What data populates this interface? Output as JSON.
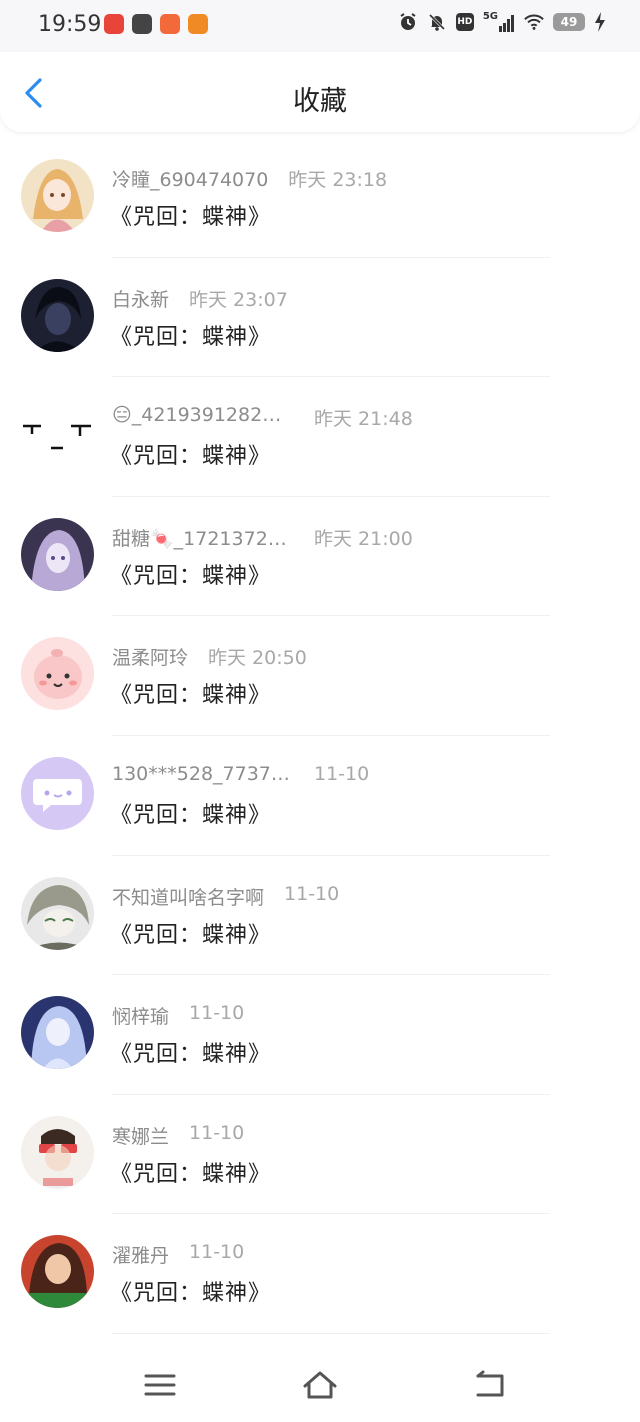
{
  "status_bar": {
    "time": "19:59",
    "hd_label": "HD",
    "network_label": "5G",
    "battery_level": "49",
    "app_icon_colors": [
      "#e8443a",
      "#444444",
      "#f36a3a",
      "#f08a24"
    ]
  },
  "header": {
    "title": "收藏",
    "back_icon": "chevron-left-icon",
    "accent_color": "#2d8cf0"
  },
  "items": [
    {
      "username": "冷瞳_690474070",
      "time": "昨天 23:18",
      "title": "《咒回：蝶神》",
      "avatar_colors": [
        "#f3e3c6",
        "#e8b36a"
      ]
    },
    {
      "username": "白永新",
      "time": "昨天 23:07",
      "title": "《咒回：蝶神》",
      "avatar_colors": [
        "#1c2030",
        "#3a4060"
      ]
    },
    {
      "username": "😑_4219391282…",
      "time": "昨天 21:48",
      "title": "《咒回：蝶神》",
      "avatar_colors": [
        "#ffffff",
        "#111111"
      ]
    },
    {
      "username": "甜糖🍬_1721372…",
      "time": "昨天 21:00",
      "title": "《咒回：蝶神》",
      "avatar_colors": [
        "#3a3450",
        "#b7a8d6"
      ]
    },
    {
      "username": "温柔阿玲",
      "time": "昨天 20:50",
      "title": "《咒回：蝶神》",
      "avatar_colors": [
        "#fde0e0",
        "#f4b1b1"
      ]
    },
    {
      "username": "130***528_7737…",
      "time": "11-10",
      "title": "《咒回：蝶神》",
      "avatar_colors": [
        "#d6c8f5",
        "#ffffff"
      ]
    },
    {
      "username": "不知道叫啥名字啊",
      "time": "11-10",
      "title": "《咒回：蝶神》",
      "avatar_colors": [
        "#9a9a8c",
        "#e8e8e8"
      ]
    },
    {
      "username": "悯梓瑜",
      "time": "11-10",
      "title": "《咒回：蝶神》",
      "avatar_colors": [
        "#2a3570",
        "#b8c6f2"
      ]
    },
    {
      "username": "寒娜兰",
      "time": "11-10",
      "title": "《咒回：蝶神》",
      "avatar_colors": [
        "#f4f0ec",
        "#e24545"
      ]
    },
    {
      "username": "濯雅丹",
      "time": "11-10",
      "title": "《咒回：蝶神》",
      "avatar_colors": [
        "#c8442e",
        "#f0c8a8"
      ]
    }
  ],
  "nav": {
    "menu_icon": "menu-icon",
    "home_icon": "home-icon",
    "back_icon": "back-icon"
  }
}
